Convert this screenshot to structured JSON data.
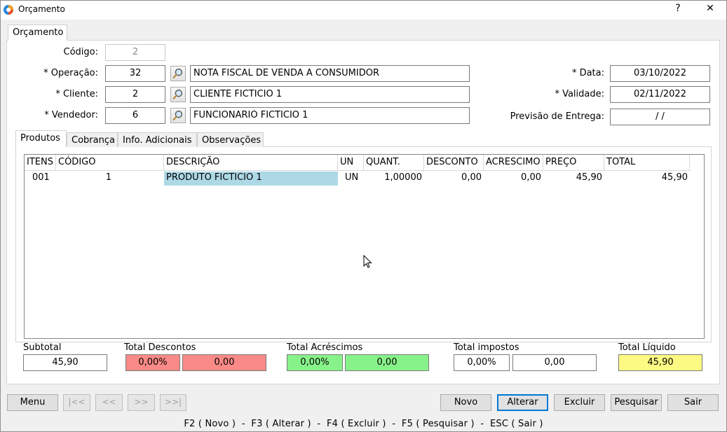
{
  "window": {
    "title": "Orçamento",
    "help": "?",
    "close": "✕"
  },
  "main_tab": "Orçamento",
  "form": {
    "codigo_label": "Código:",
    "codigo_value": "2",
    "operacao_label": "* Operação:",
    "operacao_value": "32",
    "operacao_desc": "NOTA FISCAL DE VENDA A CONSUMIDOR",
    "cliente_label": "* Cliente:",
    "cliente_value": "2",
    "cliente_desc": "CLIENTE FICTICIO 1",
    "vendedor_label": "* Vendedor:",
    "vendedor_value": "6",
    "vendedor_desc": "FUNCIONARIO FICTICIO 1",
    "data_label": "* Data:",
    "data_value": "03/10/2022",
    "validade_label": "* Validade:",
    "validade_value": "02/11/2022",
    "previsao_label": "Previsão de Entrega:",
    "previsao_value": "/  /"
  },
  "sub_tabs": [
    "Produtos",
    "Cobrança",
    "Info. Adicionais",
    "Observações"
  ],
  "grid": {
    "headers": [
      "ITENS",
      "CÓDIGO",
      "DESCRIÇÃO",
      "UN",
      "QUANT.",
      "DESCONTO",
      "ACRESCIMO",
      "PREÇO",
      "TOTAL"
    ],
    "rows": [
      [
        "001",
        "1",
        "PRODUTO FICTICIO 1",
        "UN",
        "1,00000",
        "0,00",
        "0,00",
        "45,90",
        "45,90"
      ]
    ]
  },
  "totals": {
    "subtotal_label": "Subtotal",
    "subtotal": "45,90",
    "descontos_label": "Total Descontos",
    "descontos_pct": "0,00%",
    "descontos_val": "0,00",
    "acrescimos_label": "Total Acréscimos",
    "acrescimos_pct": "0,00%",
    "acrescimos_val": "0,00",
    "impostos_label": "Total impostos",
    "impostos_pct": "0,00%",
    "impostos_val": "0,00",
    "liquido_label": "Total Líquido",
    "liquido": "45,90"
  },
  "colors": {
    "discount": "#f98a87",
    "addition": "#88f28a",
    "net": "#fdfa84",
    "selection": "#add8e6"
  },
  "buttons": {
    "menu": "Menu",
    "first": "|<<",
    "prev": "<<",
    "next": ">>",
    "last": ">>|",
    "novo": "Novo",
    "alterar": "Alterar",
    "excluir": "Excluir",
    "pesquisar": "Pesquisar",
    "sair": "Sair"
  },
  "status_bar": "F2 ( Novo )  -  F3 ( Alterar )  -  F4 ( Excluir )  -  F5 ( Pesquisar )  -  ESC ( Sair )",
  "icons": {
    "app": "app-logo-icon",
    "lookup": "magnifier-icon",
    "cursor": "mouse-pointer-icon"
  }
}
